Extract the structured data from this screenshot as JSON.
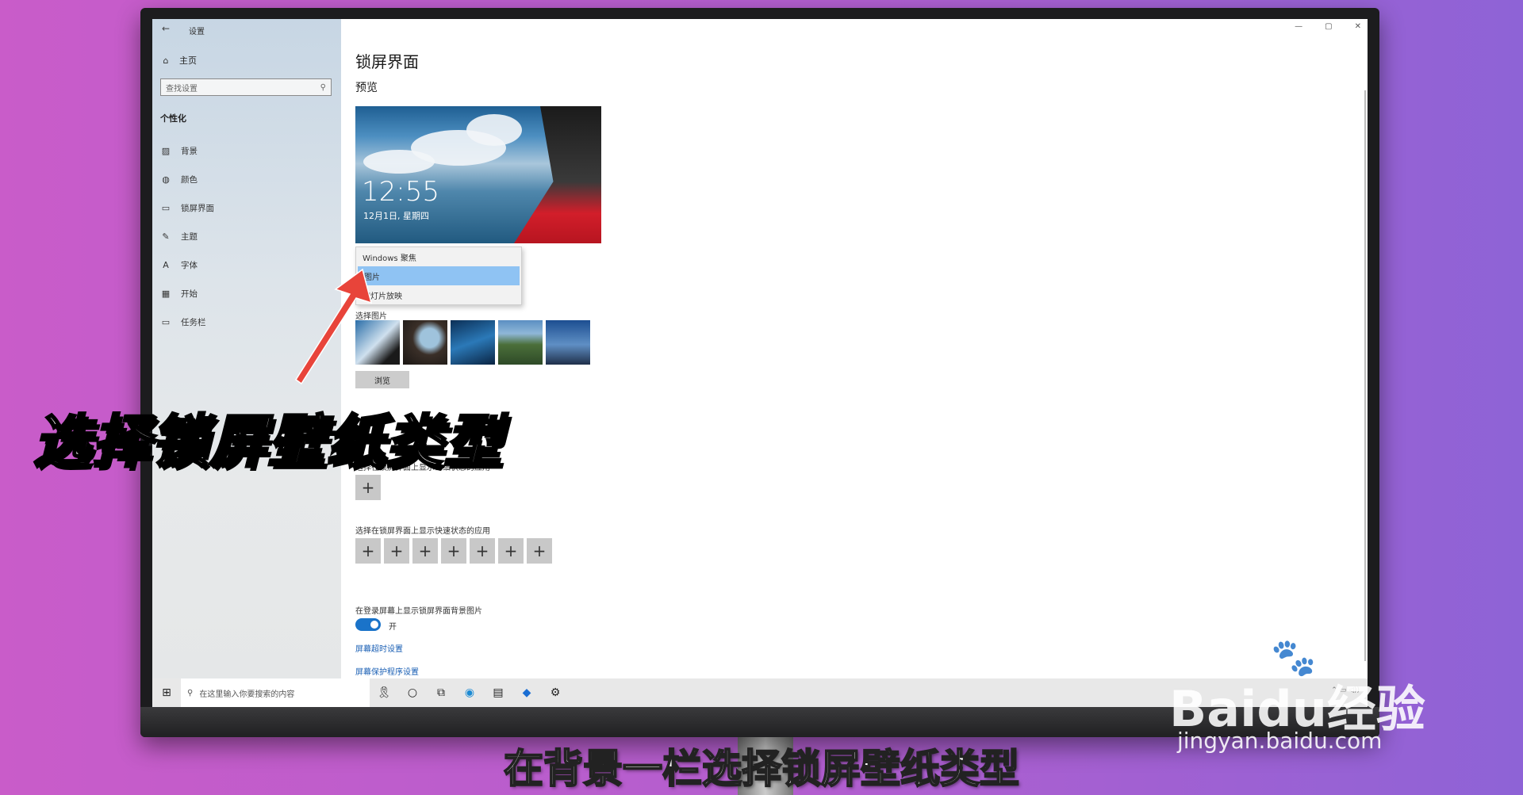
{
  "window": {
    "back_icon": "back-arrow-icon",
    "title": "设置",
    "controls": [
      "—",
      "▢",
      "✕"
    ]
  },
  "sidebar": {
    "home_label": "主页",
    "search_placeholder": "查找设置",
    "section_title": "个性化",
    "items": [
      {
        "label": "背景",
        "icon": "picture-icon"
      },
      {
        "label": "颜色",
        "icon": "palette-icon"
      },
      {
        "label": "锁屏界面",
        "icon": "lock-screen-icon"
      },
      {
        "label": "主题",
        "icon": "brush-icon"
      },
      {
        "label": "字体",
        "icon": "font-icon"
      },
      {
        "label": "开始",
        "icon": "start-icon"
      },
      {
        "label": "任务栏",
        "icon": "taskbar-icon"
      }
    ]
  },
  "main": {
    "page_title": "锁屏界面",
    "preview_label": "预览",
    "preview_time": "12:55",
    "preview_date": "12月1日, 星期四",
    "dropdown_options": [
      "Windows 聚焦",
      "图片",
      "幻灯片放映"
    ],
    "dropdown_selected": "图片",
    "choose_picture_label": "选择图片",
    "browse_label": "浏览",
    "detail_status_label": "选择在锁屏界面上显示详细状态的应用",
    "quick_status_label": "选择在锁屏界面上显示快速状态的应用",
    "plus_symbol": "+",
    "login_bg_label": "在登录屏幕上显示锁屏界面背景图片",
    "toggle_state": "开",
    "link_timeout": "屏幕超时设置",
    "link_screensaver": "屏幕保护程序设置"
  },
  "taskbar": {
    "search_placeholder": "在这里输入你要搜索的内容"
  },
  "overlay": {
    "headline": "选择锁屏壁纸类型",
    "caption": "在背景一栏选择锁屏壁纸类型"
  },
  "watermark": {
    "brand": "Baidu经验",
    "url": "jingyan.baidu.com"
  },
  "colors": {
    "accent": "#1a73c9",
    "dropdown_selected": "#8fc3f3",
    "arrow": "#e8443a"
  }
}
